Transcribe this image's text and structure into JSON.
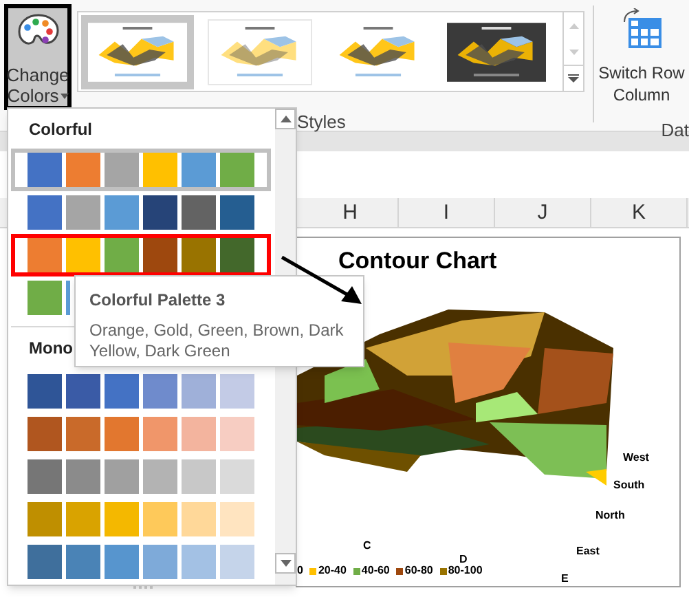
{
  "ribbon": {
    "change_colors": {
      "label_line1": "Change",
      "label_line2": "Colors",
      "expanded": true
    },
    "group_label": "Styles",
    "switch_button": {
      "label_line1": "Switch Row",
      "label_line2": "Column"
    },
    "next_group_label": "Dat"
  },
  "sheet": {
    "columns": [
      "H",
      "I",
      "J",
      "K"
    ]
  },
  "color_menu": {
    "sections": [
      {
        "title": "Colorful",
        "palettes": [
          {
            "selected": true,
            "highlighted": false,
            "swatches": [
              {
                "color": "#4472c4"
              },
              {
                "color": "#ed7d31"
              },
              {
                "color": "#a5a5a5"
              },
              {
                "color": "#ffc000"
              },
              {
                "color": "#5b9bd5"
              },
              {
                "color": "#70ad47"
              }
            ]
          },
          {
            "selected": false,
            "highlighted": false,
            "swatches": [
              {
                "color": "#4472c4"
              },
              {
                "color": "#a5a5a5"
              },
              {
                "color": "#5b9bd5"
              },
              {
                "color": "#264478"
              },
              {
                "color": "#636363"
              },
              {
                "color": "#255e91"
              }
            ]
          },
          {
            "selected": false,
            "highlighted": true,
            "swatches": [
              {
                "color": "#ed7d31"
              },
              {
                "color": "#ffc000"
              },
              {
                "color": "#70ad47"
              },
              {
                "color": "#9e480e"
              },
              {
                "color": "#997300"
              },
              {
                "color": "#43682b"
              }
            ]
          },
          {
            "selected": false,
            "highlighted": false,
            "swatches": [
              {
                "color": "#70ad47"
              },
              {
                "color": "#5b9bd5"
              }
            ]
          }
        ]
      },
      {
        "title": "Mono",
        "palettes": [
          {
            "selected": false,
            "highlighted": false,
            "swatches": [
              {
                "color": "#2f5597"
              },
              {
                "color": "#3a5ba6"
              },
              {
                "color": "#4472c4"
              },
              {
                "color": "#6f8bcc"
              },
              {
                "color": "#9fb0d9"
              },
              {
                "color": "#c3cbe6"
              }
            ]
          },
          {
            "selected": false,
            "highlighted": false,
            "swatches": [
              {
                "color": "#b0561f"
              },
              {
                "color": "#c96a2a"
              },
              {
                "color": "#e2772f"
              },
              {
                "color": "#f0966a"
              },
              {
                "color": "#f3b49e"
              },
              {
                "color": "#f7cdc2"
              }
            ]
          },
          {
            "selected": false,
            "highlighted": false,
            "swatches": [
              {
                "color": "#767676"
              },
              {
                "color": "#8b8b8b"
              },
              {
                "color": "#a0a0a0"
              },
              {
                "color": "#b3b3b3"
              },
              {
                "color": "#c8c8c8"
              },
              {
                "color": "#dadada"
              }
            ]
          },
          {
            "selected": false,
            "highlighted": false,
            "swatches": [
              {
                "color": "#bf8f00"
              },
              {
                "color": "#d9a300"
              },
              {
                "color": "#f4b800"
              },
              {
                "color": "#fec95a"
              },
              {
                "color": "#ffd899"
              },
              {
                "color": "#ffe4c0"
              }
            ]
          },
          {
            "selected": false,
            "highlighted": false,
            "swatches": [
              {
                "color": "#3f6f9c"
              },
              {
                "color": "#4a83b6"
              },
              {
                "color": "#5795ce"
              },
              {
                "color": "#7eaad9"
              },
              {
                "color": "#a3c1e4"
              },
              {
                "color": "#c5d4ea"
              }
            ]
          }
        ]
      }
    ]
  },
  "tooltip": {
    "title": "Colorful Palette 3",
    "description": "Orange, Gold, Green, Brown, Dark Yellow, Dark Green"
  },
  "chart": {
    "title": "Contour Chart",
    "x_labels": [
      "C",
      "D",
      "E"
    ],
    "depth_labels": [
      "West",
      "South",
      "North",
      "East"
    ],
    "legend": [
      {
        "label": "0"
      },
      {
        "label": "20-40",
        "color": "#ffc000"
      },
      {
        "label": "40-60",
        "color": "#70ad47"
      },
      {
        "label": "60-80",
        "color": "#9e480e"
      },
      {
        "label": "80-100",
        "color": "#997300"
      }
    ]
  }
}
